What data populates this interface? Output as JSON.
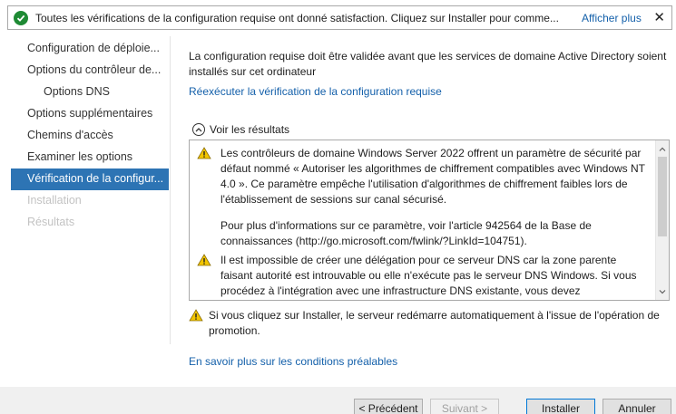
{
  "banner": {
    "message": "Toutes les vérifications de la configuration requise ont donné satisfaction. Cliquez sur Installer pour comme...",
    "more_link": "Afficher plus",
    "close": "✕",
    "icon": "success-check-icon",
    "status_color": "#1e8a34"
  },
  "sidebar": {
    "items": [
      {
        "label": "Configuration de déploie...",
        "state": "normal"
      },
      {
        "label": "Options du contrôleur de...",
        "state": "normal"
      },
      {
        "label": "Options DNS",
        "state": "normal"
      },
      {
        "label": "Options supplémentaires",
        "state": "normal"
      },
      {
        "label": "Chemins d'accès",
        "state": "normal"
      },
      {
        "label": "Examiner les options",
        "state": "normal"
      },
      {
        "label": "Vérification de la configur...",
        "state": "active"
      },
      {
        "label": "Installation",
        "state": "disabled"
      },
      {
        "label": "Résultats",
        "state": "disabled"
      }
    ],
    "active_color": "#2d74b4"
  },
  "content": {
    "intro": "La configuration requise doit être validée avant que les services de domaine Active Directory soient installés sur cet ordinateur",
    "rerun_link": "Réexécuter la vérification de la configuration requise",
    "results_toggle": "Voir les résultats",
    "results": [
      "Les contrôleurs de domaine Windows Server 2022 offrent un paramètre de sécurité par défaut nommé « Autoriser les algorithmes de chiffrement compatibles avec Windows NT 4.0 ». Ce paramètre empêche l'utilisation d'algorithmes de chiffrement faibles lors de l'établissement de sessions sur canal sécurisé.",
      "Pour plus d'informations sur ce paramètre, voir l'article 942564 de la Base de connaissances (http://go.microsoft.com/fwlink/?LinkId=104751).",
      "Il est impossible de créer une délégation pour ce serveur DNS car la zone parente faisant autorité est introuvable ou elle n'exécute pas le serveur DNS Windows. Si vous procédez à l'intégration avec une infrastructure DNS existante, vous devez"
    ],
    "restart_note": "Si vous cliquez sur Installer, le serveur redémarre automatiquement à l'issue de l'opération de promotion.",
    "learn_more_link": "En savoir plus sur les conditions préalables",
    "link_color": "#1460aa",
    "warning_color": "#f2c500"
  },
  "footer": {
    "previous": "< Précédent",
    "next": "Suivant >",
    "install": "Installer",
    "cancel": "Annuler"
  }
}
